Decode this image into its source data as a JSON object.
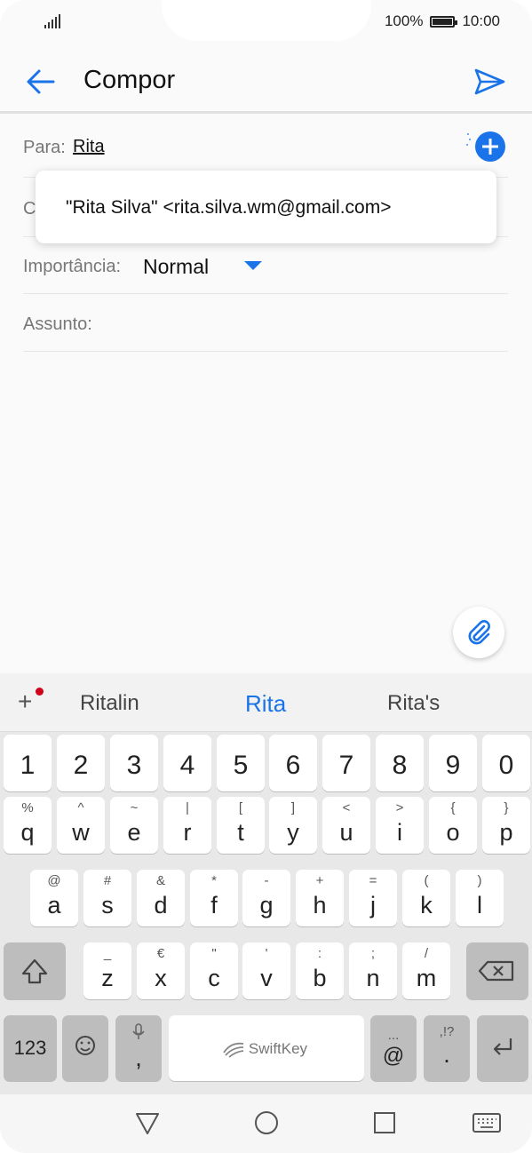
{
  "status_bar": {
    "battery": "100%",
    "time": "10:00"
  },
  "app_bar": {
    "title": "Compor"
  },
  "form": {
    "to_label": "Para:",
    "to_chip": "Rita",
    "cc_label": "C",
    "importance_label": "Importância:",
    "importance_value": "Normal",
    "subject_label": "Assunto:"
  },
  "suggestion": {
    "text": "\"Rita Silva\" <rita.silva.wm@gmail.com>"
  },
  "keyboard": {
    "predictions": [
      "Ritalin",
      "Rita",
      "Rita's"
    ],
    "number_row": [
      "1",
      "2",
      "3",
      "4",
      "5",
      "6",
      "7",
      "8",
      "9",
      "0"
    ],
    "row1": [
      {
        "main": "q",
        "sub": "%"
      },
      {
        "main": "w",
        "sub": "^"
      },
      {
        "main": "e",
        "sub": "~"
      },
      {
        "main": "r",
        "sub": "|"
      },
      {
        "main": "t",
        "sub": "["
      },
      {
        "main": "y",
        "sub": "]"
      },
      {
        "main": "u",
        "sub": "<"
      },
      {
        "main": "i",
        "sub": ">"
      },
      {
        "main": "o",
        "sub": "{"
      },
      {
        "main": "p",
        "sub": "}"
      }
    ],
    "row2": [
      {
        "main": "a",
        "sub": "@"
      },
      {
        "main": "s",
        "sub": "#"
      },
      {
        "main": "d",
        "sub": "&"
      },
      {
        "main": "f",
        "sub": "*"
      },
      {
        "main": "g",
        "sub": "-"
      },
      {
        "main": "h",
        "sub": "+"
      },
      {
        "main": "j",
        "sub": "="
      },
      {
        "main": "k",
        "sub": "("
      },
      {
        "main": "l",
        "sub": ")"
      }
    ],
    "row3": [
      {
        "main": "z",
        "sub": "_"
      },
      {
        "main": "x",
        "sub": "€"
      },
      {
        "main": "c",
        "sub": "\""
      },
      {
        "main": "v",
        "sub": "'"
      },
      {
        "main": "b",
        "sub": ":"
      },
      {
        "main": "n",
        "sub": ";"
      },
      {
        "main": "m",
        "sub": "/"
      }
    ],
    "numbers_key": "123",
    "comma_key": ",",
    "space_label": "SwiftKey",
    "at_key": "@",
    "at_sub": "...",
    "period_key": ".",
    "period_sub": ",!?"
  }
}
